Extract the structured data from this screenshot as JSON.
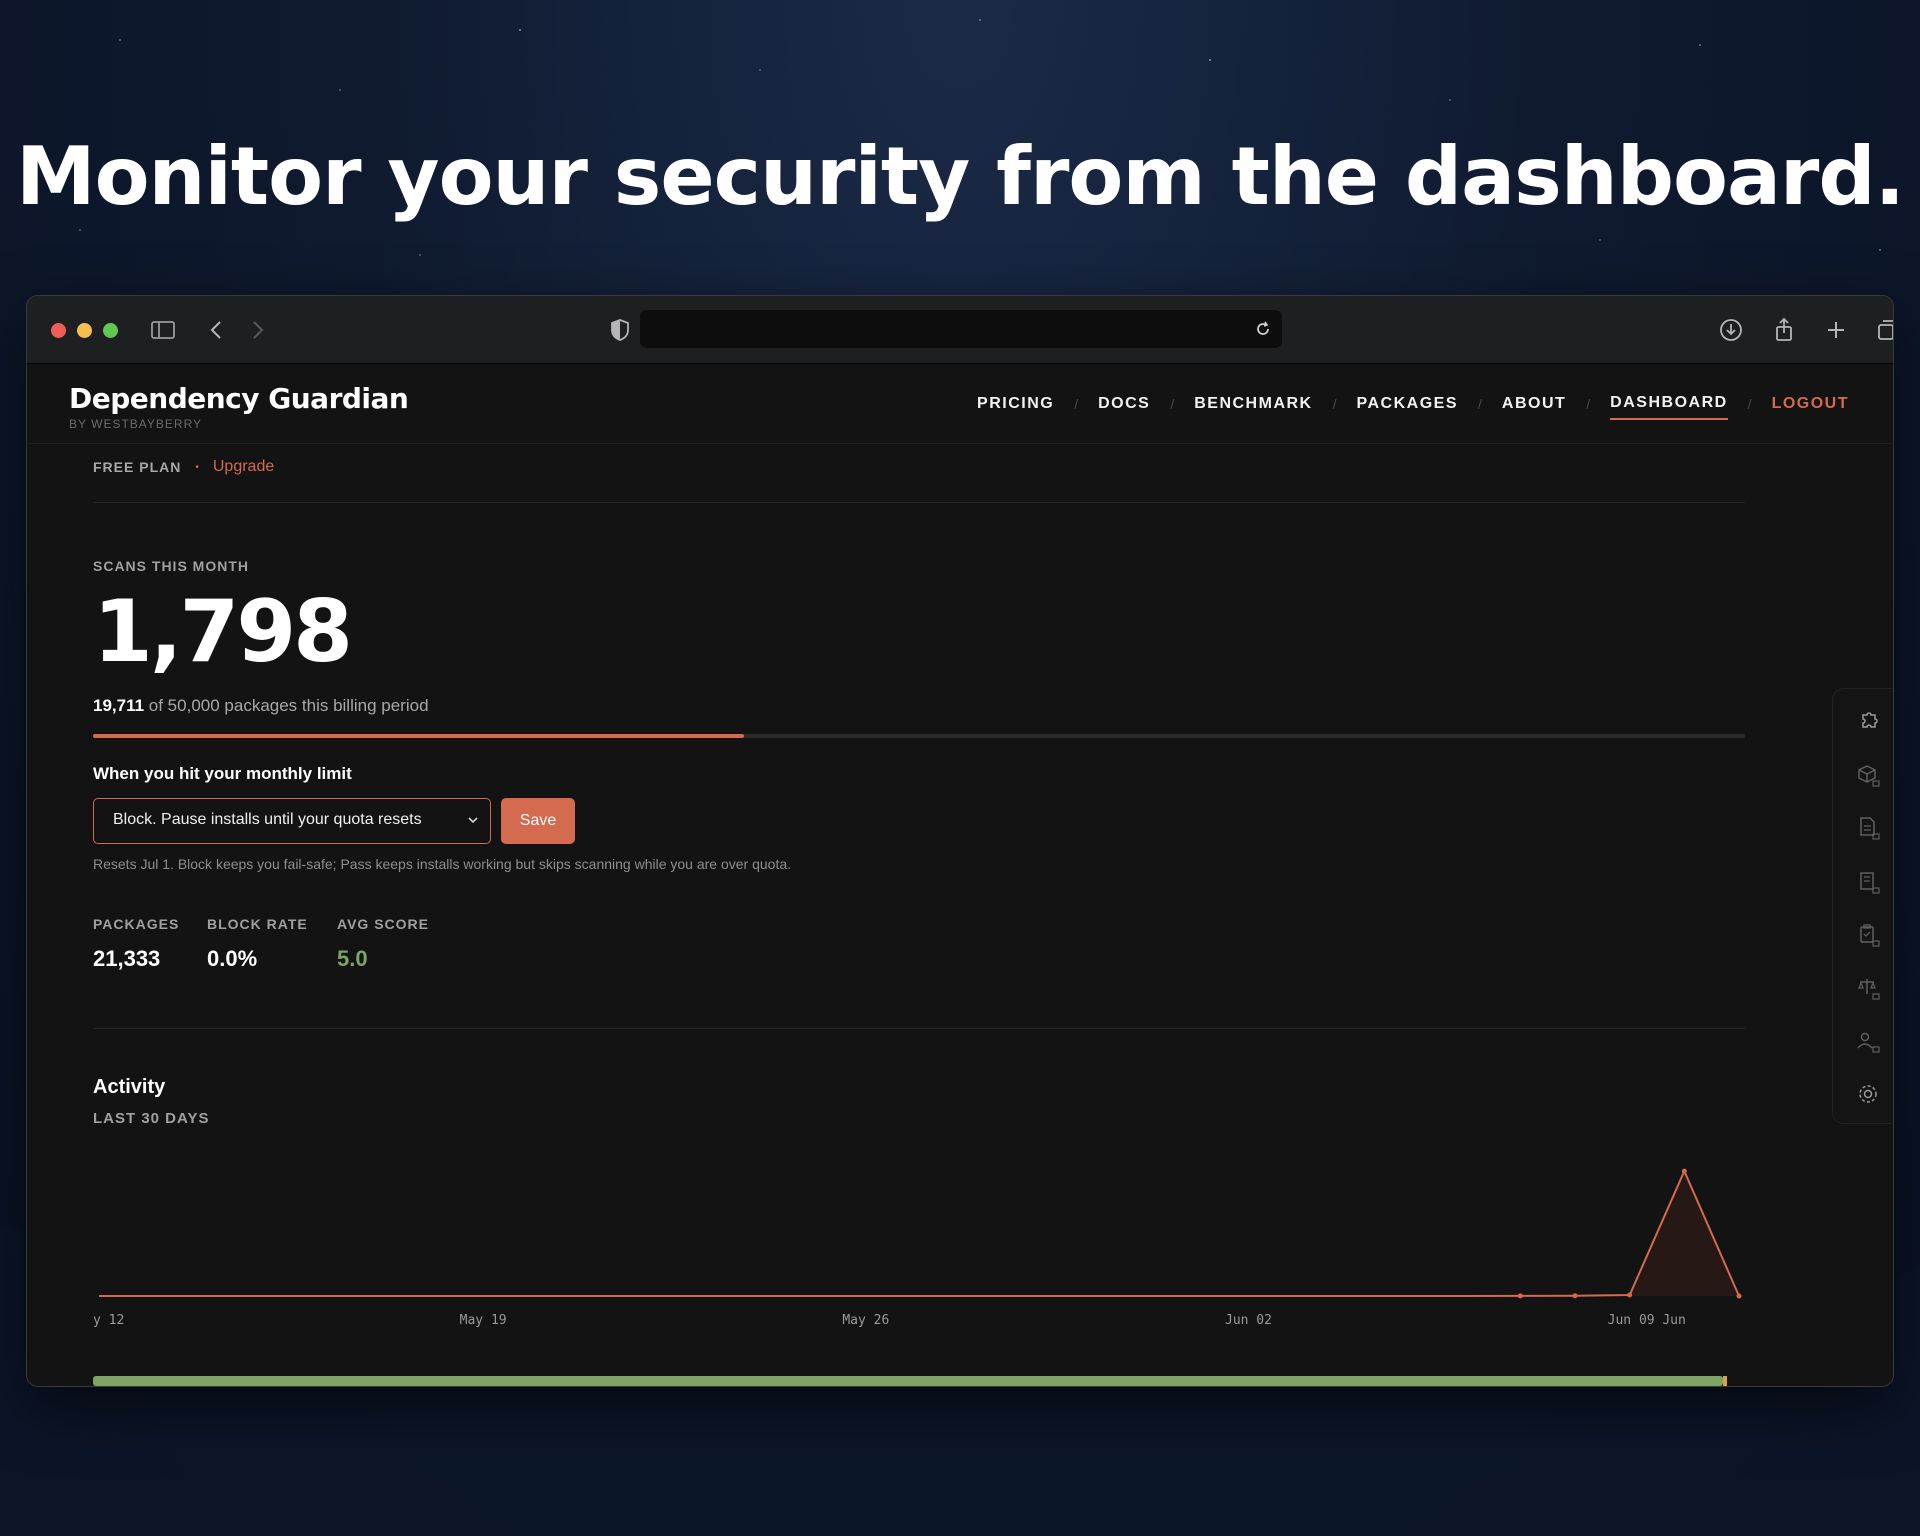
{
  "headline": "Monitor your security from the dashboard.",
  "brand": {
    "name": "Dependency Guardian",
    "sub": "BY WESTBAYBERRY"
  },
  "nav": [
    {
      "label": "PRICING"
    },
    {
      "label": "DOCS"
    },
    {
      "label": "BENCHMARK"
    },
    {
      "label": "PACKAGES"
    },
    {
      "label": "ABOUT"
    },
    {
      "label": "DASHBOARD",
      "active": true
    },
    {
      "label": "LOGOUT"
    }
  ],
  "nav_separator": "/",
  "plan": {
    "label": "FREE PLAN",
    "separator": "•",
    "upgrade": "Upgrade"
  },
  "scans": {
    "label": "SCANS THIS MONTH",
    "value": "1,798",
    "used": "19,711",
    "billing_text": " of 50,000 packages this billing period",
    "progress_fraction": 0.394
  },
  "limit": {
    "label": "When you hit your monthly limit",
    "selected_option": "Block. Pause installs until your quota resets",
    "save_label": "Save",
    "note": "Resets Jul 1. Block keeps you fail-safe; Pass keeps installs working but skips scanning while you are over quota."
  },
  "stats": [
    {
      "label": "PACKAGES",
      "value": "21,333"
    },
    {
      "label": "BLOCK RATE",
      "value": "0.0%"
    },
    {
      "label": "AVG SCORE",
      "value": "5.0"
    }
  ],
  "activity": {
    "title": "Activity",
    "subtitle": "LAST 30 DAYS"
  },
  "chart_data": {
    "type": "area",
    "x_tick_labels": [
      "y 12",
      "May 19",
      "May 26",
      "Jun 02",
      "Jun 09",
      "Jun"
    ],
    "x_ticks_day_index": [
      0,
      7,
      14,
      21,
      28,
      29
    ],
    "values": [
      0,
      0,
      0,
      0,
      0,
      0,
      0,
      0,
      0,
      0,
      0,
      0,
      0,
      0,
      0,
      0,
      0,
      0,
      0,
      0,
      0,
      0,
      0,
      0,
      0,
      0,
      2,
      4,
      14,
      1798,
      0
    ],
    "ylim": [
      0,
      1900
    ],
    "line_color": "#d46a4e",
    "grid": false
  },
  "colors": {
    "accent": "#d46a4e",
    "success": "#7ea563",
    "bottom_bar": "#7ea563",
    "bottom_bar_marker": "#e0a33a"
  },
  "rail_icons": [
    "puzzle-icon",
    "package-lock-icon",
    "document-lock-icon",
    "building-lock-icon",
    "clipboard-lock-icon",
    "scale-lock-icon",
    "users-lock-icon",
    "settings-icon"
  ]
}
